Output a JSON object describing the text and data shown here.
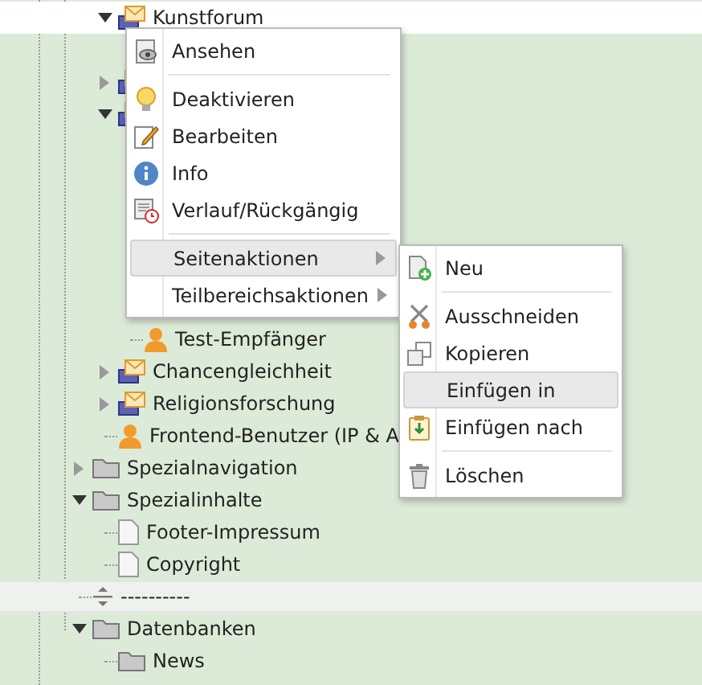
{
  "tree": [
    {
      "label": "Kunstforum",
      "kind": "mail",
      "expanded": true,
      "selected": true
    },
    {
      "kind": "mail",
      "expanded": false,
      "selected": false
    },
    {
      "kind": "mail",
      "expanded": true,
      "selected": false,
      "children": [
        {
          "label": "Test-Empfänger",
          "kind": "user",
          "selected": false
        }
      ]
    },
    {
      "label": "Chancengleichheit",
      "kind": "mail",
      "expanded": false,
      "selected": false
    },
    {
      "label": "Religionsforschung",
      "kind": "mail",
      "expanded": false,
      "selected": false
    },
    {
      "label": "Frontend-Benutzer (IP & A",
      "kind": "user",
      "selected": false
    },
    {
      "label": "Spezialnavigation",
      "kind": "folder",
      "expanded": false,
      "selected": false
    },
    {
      "label": "Spezialinhalte",
      "kind": "folder",
      "expanded": true,
      "selected": false,
      "children": [
        {
          "label": "Footer-Impressum",
          "kind": "page",
          "selected": false
        },
        {
          "label": "Copyright",
          "kind": "page",
          "selected": false
        }
      ]
    },
    {
      "label": "----------",
      "kind": "separator",
      "selected": true
    },
    {
      "label": "Datenbanken",
      "kind": "folder",
      "expanded": true,
      "selected": false,
      "children": [
        {
          "label": "News",
          "kind": "folder",
          "selected": false
        }
      ]
    }
  ],
  "context_menu": {
    "groups": [
      [
        {
          "label": "Ansehen",
          "kind": "view",
          "selected": false,
          "submenu": false
        }
      ],
      [
        {
          "label": "Deaktivieren",
          "kind": "bulb",
          "selected": false,
          "submenu": false
        },
        {
          "label": "Bearbeiten",
          "kind": "edit",
          "selected": false,
          "submenu": false
        },
        {
          "label": "Info",
          "kind": "info",
          "selected": false,
          "submenu": false
        },
        {
          "label": "Verlauf/Rückgängig",
          "kind": "history",
          "selected": false,
          "submenu": false
        }
      ],
      [
        {
          "label": "Seitenaktionen",
          "selected": true,
          "submenu": true
        },
        {
          "label": "Teilbereichsaktionen",
          "selected": false,
          "submenu": true
        }
      ]
    ]
  },
  "submenu": {
    "groups": [
      [
        {
          "label": "Neu",
          "kind": "new",
          "selected": false
        }
      ],
      [
        {
          "label": "Ausschneiden",
          "kind": "cut",
          "selected": false
        },
        {
          "label": "Kopieren",
          "kind": "copy",
          "selected": false
        },
        {
          "label": "Einfügen in",
          "selected": true
        },
        {
          "label": "Einfügen nach",
          "kind": "paste",
          "selected": false
        }
      ],
      [
        {
          "label": "Löschen",
          "kind": "trash",
          "selected": false
        }
      ]
    ]
  }
}
